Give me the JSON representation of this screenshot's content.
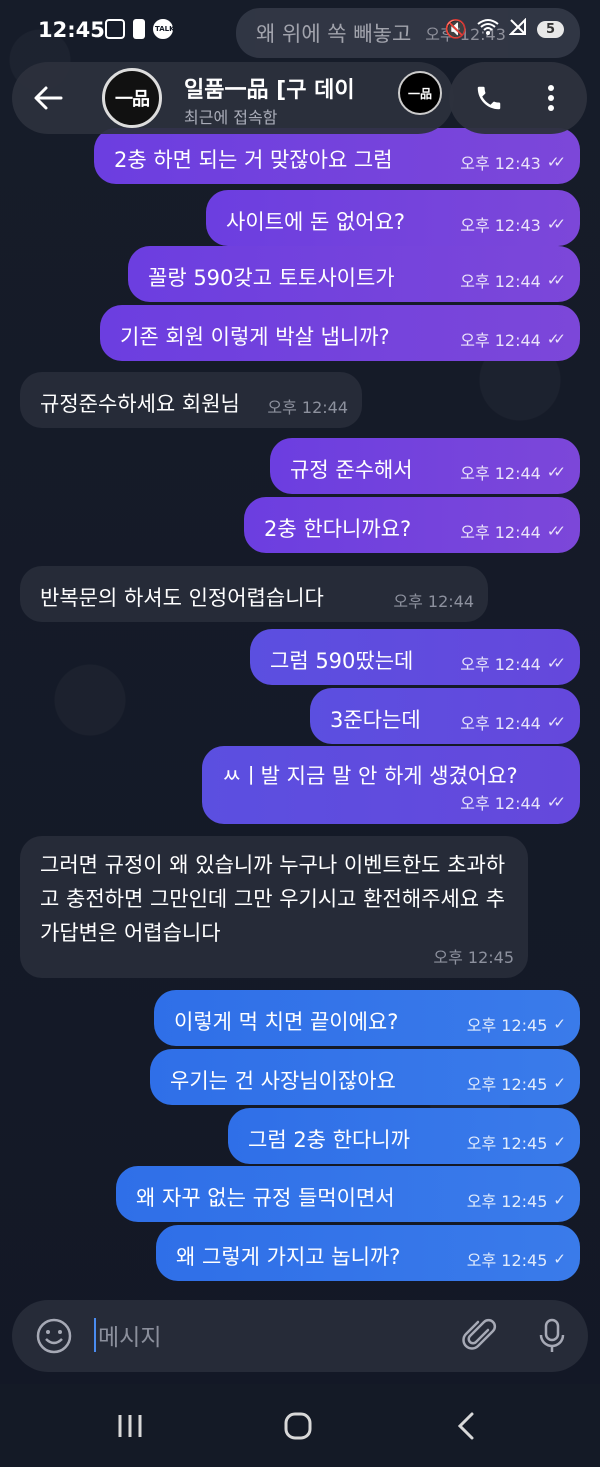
{
  "status_bar": {
    "time": "12:45",
    "battery": "5",
    "talk_label": "TALK"
  },
  "peek_message": {
    "text": "왜 위에 쏙 빼놓고",
    "time": "오후 12:43"
  },
  "header": {
    "title": "일품一品 [구 데이",
    "subtitle": "최근에 접속함",
    "avatar_text": "一品"
  },
  "messages": [
    {
      "dir": "out",
      "text": "2충 하면 되는 거 맞잖아요 그럼",
      "time": "오후 12:43",
      "status": "read"
    },
    {
      "dir": "out",
      "text": "사이트에 돈 없어요?",
      "time": "오후 12:43",
      "status": "read"
    },
    {
      "dir": "out",
      "text": "꼴랑 590갖고 토토사이트가",
      "time": "오후 12:44",
      "status": "read"
    },
    {
      "dir": "out",
      "text": "기존 회원 이렇게 박살 냅니까?",
      "time": "오후 12:44",
      "status": "read"
    },
    {
      "dir": "in",
      "text": "규정준수하세요 회원님",
      "time": "오후 12:44"
    },
    {
      "dir": "out",
      "text": "규정 준수해서",
      "time": "오후 12:44",
      "status": "read"
    },
    {
      "dir": "out",
      "text": "2충 한다니까요?",
      "time": "오후 12:44",
      "status": "read"
    },
    {
      "dir": "in",
      "text": "반복문의 하셔도 인정어렵습니다",
      "time": "오후 12:44"
    },
    {
      "dir": "out",
      "text": "그럼 590땄는데",
      "time": "오후 12:44",
      "status": "read"
    },
    {
      "dir": "out",
      "text": "3준다는데",
      "time": "오후 12:44",
      "status": "read"
    },
    {
      "dir": "out",
      "text": "ㅆㅣ발 지금 말 안 하게 생겼어요?",
      "time": "오후 12:44",
      "status": "read"
    },
    {
      "dir": "in",
      "text": "그러면 규정이 왜 있습니까 누구나 이벤트한도 초과하고 충전하면 그만인데 그만 우기시고 환전해주세요 추가답변은 어렵습니다",
      "time": "오후 12:45"
    },
    {
      "dir": "out",
      "text": "이렇게 먹 치면 끝이에요?",
      "time": "오후 12:45",
      "status": "sent"
    },
    {
      "dir": "out",
      "text": "우기는 건 사장님이잖아요",
      "time": "오후 12:45",
      "status": "sent"
    },
    {
      "dir": "out",
      "text": "그럼 2충 한다니까",
      "time": "오후 12:45",
      "status": "sent"
    },
    {
      "dir": "out",
      "text": "왜 자꾸 없는 규정 들먹이면서",
      "time": "오후 12:45",
      "status": "sent"
    },
    {
      "dir": "out",
      "text": "왜 그렇게 가지고 놉니까?",
      "time": "오후 12:45",
      "status": "sent"
    }
  ],
  "input": {
    "placeholder": "메시지"
  },
  "colors": {
    "outgoing_read": "#7c47d9",
    "outgoing_sent": "#3a7bea",
    "incoming": "#262b38",
    "background": "#141a26"
  }
}
